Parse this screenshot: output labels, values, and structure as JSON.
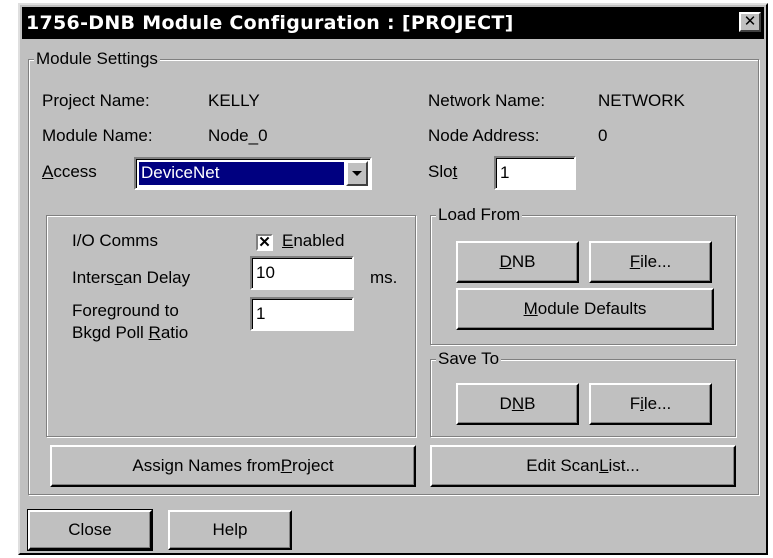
{
  "window": {
    "title": "1756-DNB Module Configuration : [PROJECT]",
    "close_glyph": "✕"
  },
  "module_settings": {
    "legend": "Module Settings",
    "project_name_label": "Project Name:",
    "project_name_value": "KELLY",
    "module_name_label": "Module Name:",
    "module_name_value": "Node_0",
    "access_label_u": "A",
    "access_label_rest": "ccess",
    "access_value": "DeviceNet",
    "network_name_label": "Network Name:",
    "network_name_value": "NETWORK",
    "node_address_label": "Node Address:",
    "node_address_value": "0",
    "slot_label_pre": "Slo",
    "slot_label_u": "t",
    "slot_value": "1"
  },
  "io_group": {
    "io_comms_label": "I/O Comms",
    "enabled_checked": "✕",
    "enabled_label_u": "E",
    "enabled_label_rest": "nabled",
    "interscan_label_pre": "Inters",
    "interscan_label_u": "c",
    "interscan_label_post": "an Delay",
    "interscan_value": "10",
    "interscan_unit": "ms.",
    "fg_label_line1": "Foreground to",
    "fg_label_line2_pre": "Bkgd Poll ",
    "fg_label_line2_u": "R",
    "fg_label_line2_post": "atio",
    "fg_value": "1"
  },
  "load_from": {
    "legend": "Load From",
    "dnb_u": "D",
    "dnb_rest": "NB",
    "file_u": "F",
    "file_rest": "ile...",
    "defaults_u": "M",
    "defaults_rest": "odule Defaults"
  },
  "save_to": {
    "legend": "Save To",
    "dnb_pre": "D",
    "dnb_u": "N",
    "dnb_post": "B",
    "file_pre": "F",
    "file_u": "i",
    "file_post": "le..."
  },
  "assign_names": {
    "pre": "Assign Names from ",
    "u": "P",
    "post": "roject"
  },
  "edit_scan": {
    "pre": "Edit Scan ",
    "u": "L",
    "post": "ist..."
  },
  "footer": {
    "close_label": "Close",
    "help_label": "Help"
  }
}
